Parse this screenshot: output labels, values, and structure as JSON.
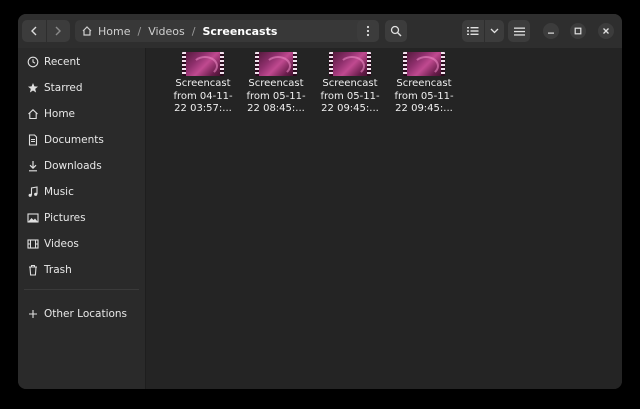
{
  "window": {
    "path": {
      "crumbs": [
        {
          "label": "Home"
        },
        {
          "label": "Videos"
        },
        {
          "label": "Screencasts"
        }
      ],
      "separator": "/"
    },
    "toolbar": {
      "back_icon": "chevron-left-icon",
      "forward_icon": "chevron-right-icon",
      "menu_icon": "vertical-dots-icon",
      "search_icon": "search-icon",
      "view_icon": "list-view-icon",
      "view_dropdown_icon": "chevron-down-icon",
      "main_menu_icon": "hamburger-icon"
    },
    "controls": [
      "minimize-icon",
      "maximize-icon",
      "close-icon"
    ]
  },
  "sidebar": {
    "items": [
      {
        "label": "Recent",
        "icon": "clock-icon"
      },
      {
        "label": "Starred",
        "icon": "star-icon"
      },
      {
        "label": "Home",
        "icon": "home-icon"
      },
      {
        "label": "Documents",
        "icon": "document-icon"
      },
      {
        "label": "Downloads",
        "icon": "download-icon"
      },
      {
        "label": "Music",
        "icon": "music-note-icon"
      },
      {
        "label": "Pictures",
        "icon": "image-icon"
      },
      {
        "label": "Videos",
        "icon": "film-icon"
      },
      {
        "label": "Trash",
        "icon": "trash-icon"
      }
    ],
    "other": {
      "label": "Other Locations",
      "icon": "plus-icon"
    }
  },
  "files": [
    {
      "line1": "Screencast",
      "line2": "from 04-11-",
      "line3": "22 03:57:..."
    },
    {
      "line1": "Screencast",
      "line2": "from 05-11-",
      "line3": "22 08:45:..."
    },
    {
      "line1": "Screencast",
      "line2": "from 05-11-",
      "line3": "22 09:45:..."
    },
    {
      "line1": "Screencast",
      "line2": "from 05-11-",
      "line3": "22 09:45:..."
    }
  ],
  "colors": {
    "window_bg": "#242424",
    "headerbar_bg": "#2e2e2e",
    "sidebar_bg": "#2a2a2a",
    "thumbnail_accent": "#8e2f6c"
  }
}
